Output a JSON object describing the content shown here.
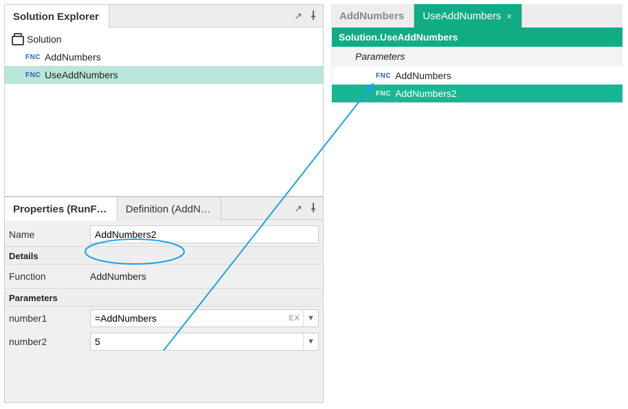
{
  "solutionExplorer": {
    "title": "Solution Explorer",
    "root": "Solution",
    "items": [
      {
        "badge": "FNC",
        "label": "AddNumbers",
        "selected": false
      },
      {
        "badge": "FNC",
        "label": "UseAddNumbers",
        "selected": true
      }
    ]
  },
  "rightTabs": {
    "inactive": "AddNumbers",
    "active": "UseAddNumbers"
  },
  "rightBody": {
    "breadcrumb": "Solution.UseAddNumbers",
    "parametersHeader": "Parameters",
    "items": [
      {
        "badge": "FNC",
        "label": "AddNumbers",
        "selected": false
      },
      {
        "badge": "FNC",
        "label": "AddNumbers2",
        "selected": true
      }
    ]
  },
  "bottomTabs": {
    "active": "Properties (RunF…",
    "inactive": "Definition (AddN…"
  },
  "properties": {
    "nameLabel": "Name",
    "nameValue": "AddNumbers2",
    "detailsHeader": "Details",
    "functionLabel": "Function",
    "functionValue": "AddNumbers",
    "parametersHeader": "Parameters",
    "params": [
      {
        "label": "number1",
        "value": "=AddNumbers",
        "hasEx": true
      },
      {
        "label": "number2",
        "value": "5",
        "hasEx": false
      }
    ],
    "exBadge": "EX"
  }
}
